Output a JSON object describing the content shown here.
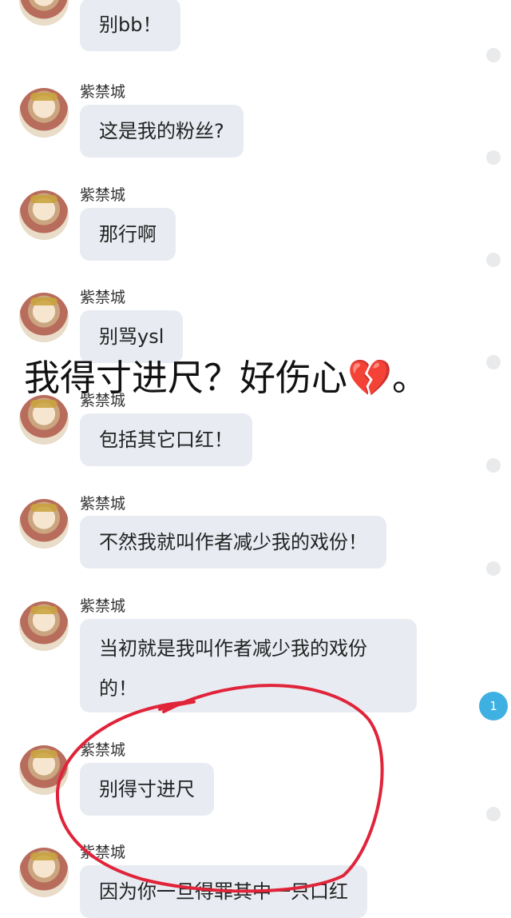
{
  "chat": {
    "messages": [
      {
        "sender": "",
        "text": "别bb！"
      },
      {
        "sender": "紫禁城",
        "text": "这是我的粉丝?"
      },
      {
        "sender": "紫禁城",
        "text": "那行啊"
      },
      {
        "sender": "紫禁城",
        "text": "别骂ysl"
      },
      {
        "sender": "紫禁城",
        "text": "包括其它口红！"
      },
      {
        "sender": "紫禁城",
        "text": "不然我就叫作者减少我的戏份！"
      },
      {
        "sender": "紫禁城",
        "text_line1": "当初就是我叫作者减少我的戏份",
        "text_line2": "的！"
      },
      {
        "sender": "紫禁城",
        "text": "别得寸进尺"
      },
      {
        "sender": "紫禁城",
        "text": "因为你一旦得罪其中一只口红"
      }
    ],
    "unread_badge": "1"
  },
  "overlay": {
    "caption": "我得寸进尺？好伤心",
    "emoji": "💔",
    "suffix": "。"
  },
  "colors": {
    "bubble": "#e8ecf2",
    "badge": "#3fb0e2",
    "annotation_circle": "#e0243a"
  },
  "icons": {
    "avatar": "avatar-icon",
    "emoji": "broken-heart-icon"
  }
}
